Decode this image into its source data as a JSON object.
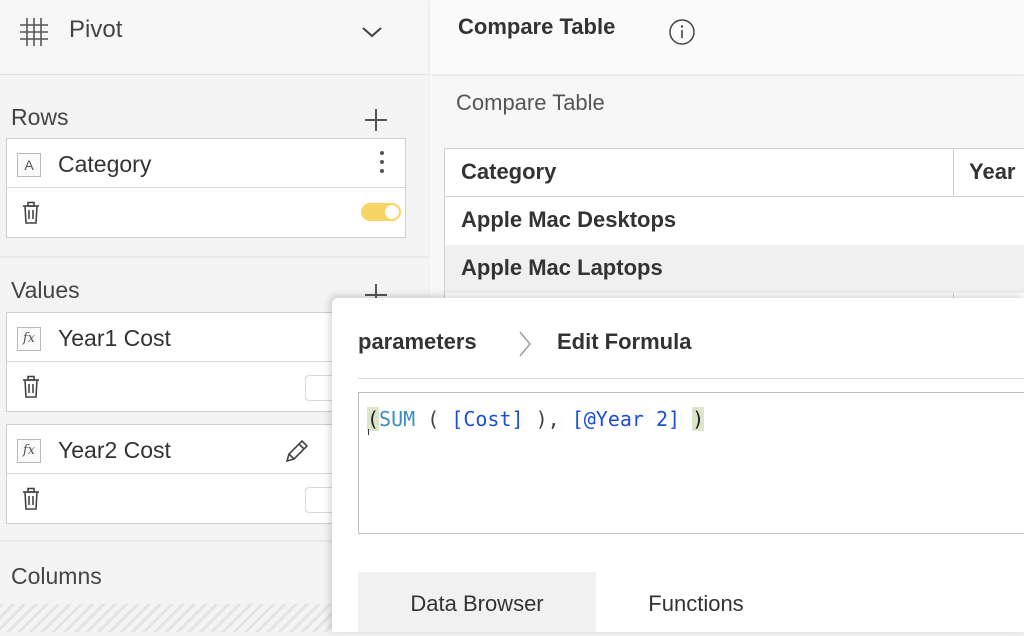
{
  "sidebar": {
    "title": "Pivot",
    "rows": {
      "label": "Rows",
      "items": [
        {
          "type_icon": "A",
          "name": "Category",
          "toggle_on": true
        }
      ]
    },
    "values": {
      "label": "Values",
      "items": [
        {
          "type_icon": "fx",
          "name": "Year1 Cost"
        },
        {
          "type_icon": "fx",
          "name": "Year2 Cost"
        }
      ]
    },
    "columns": {
      "label": "Columns"
    }
  },
  "main": {
    "header_title": "Compare Table",
    "subtitle": "Compare Table",
    "table": {
      "columns": [
        "Category",
        "Year"
      ],
      "rows": [
        "Apple Mac Desktops",
        "Apple Mac Laptops"
      ]
    }
  },
  "formula_editor": {
    "breadcrumb": [
      "parameters",
      "Edit Formula"
    ],
    "formula": {
      "open_paren": "(",
      "fn": "SUM",
      "open_fn": " ( ",
      "ref1": "[Cost]",
      "mid": " ), ",
      "ref2": "[@Year 2]",
      "close_space": " ",
      "close_paren": ")"
    },
    "tabs": [
      "Data Browser",
      "Functions"
    ],
    "active_tab": "Data Browser"
  },
  "colors": {
    "toggle_on": "#f7d463",
    "function_text": "#3a8ec0",
    "reference_text": "#1c4fd6",
    "paren_highlight": "#dde4cc"
  },
  "icons": {
    "pivot": "grid-icon",
    "collapse": "chevron-down-icon",
    "add": "plus-icon",
    "more": "kebab-menu-icon",
    "delete": "trash-icon",
    "edit": "pencil-icon",
    "info": "info-icon"
  }
}
